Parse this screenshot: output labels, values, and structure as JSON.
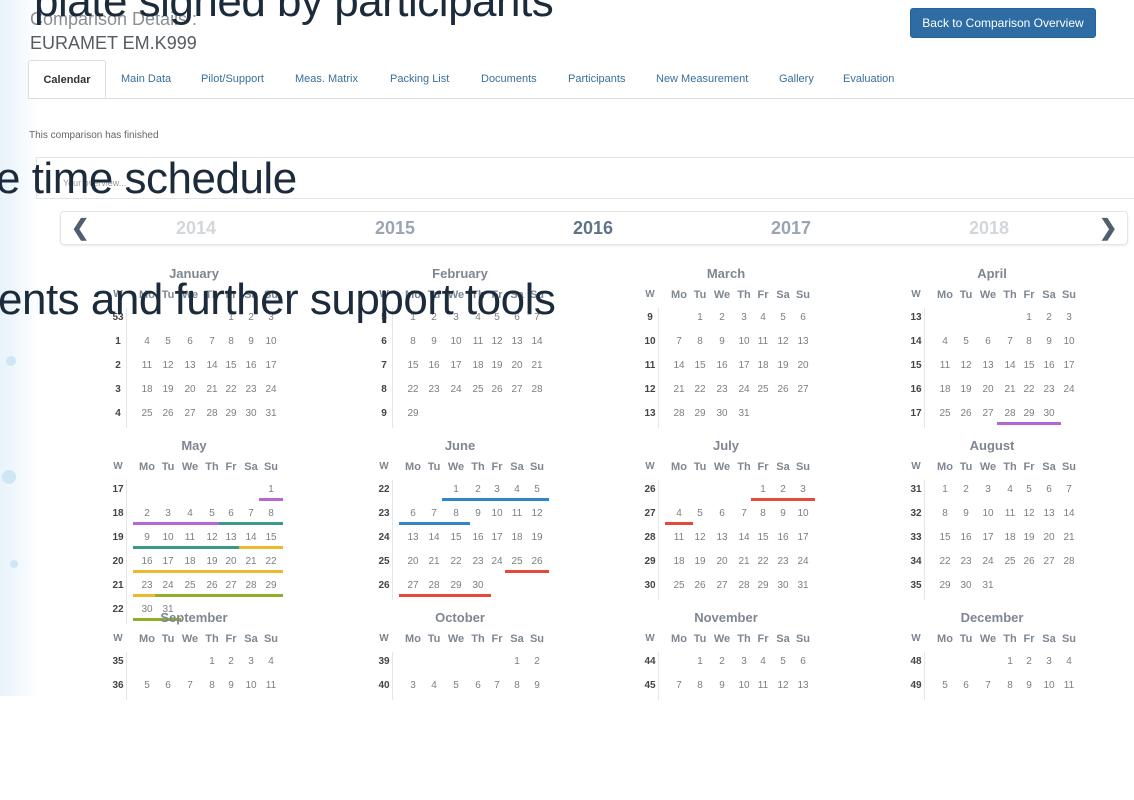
{
  "header": {
    "title": "Comparison Details :",
    "subtitle": "EURAMET EM.K999",
    "back_button": "Back to Comparison Overview"
  },
  "tabs": [
    "Calendar",
    "Main Data",
    "Pilot/Support",
    "Meas. Matrix",
    "Packing List",
    "Documents",
    "Participants",
    "New Measurement",
    "Gallery",
    "Evaluation"
  ],
  "status_text": "This comparison has finished",
  "overview_placeholder": "Your overview...",
  "overlay_texts": [
    "plate signed by participants",
    "e time schedule",
    "ents and further support tools"
  ],
  "years": [
    "2014",
    "2015",
    "2016",
    "2017",
    "2018"
  ],
  "active_year": "2016",
  "weekday_header": [
    "W",
    "Mo",
    "Tu",
    "We",
    "Th",
    "Fr",
    "Sa",
    "Su"
  ],
  "colors": {
    "purple": "#b567d9",
    "teal": "#3a9a8a",
    "yellow": "#f0b92b",
    "olive": "#8fae2b",
    "blue": "#2e86c9",
    "red": "#e8483a",
    "primary_button": "#2e6da4"
  },
  "months": [
    {
      "name": "January",
      "start": 4,
      "days": 31,
      "weeks": [
        "53",
        "1",
        "2",
        "3",
        "4"
      ],
      "underlines": []
    },
    {
      "name": "February",
      "start": 0,
      "days": 29,
      "weeks": [
        "5",
        "6",
        "7",
        "8",
        "9"
      ],
      "underlines": []
    },
    {
      "name": "March",
      "start": 1,
      "days": 31,
      "weeks": [
        "9",
        "10",
        "11",
        "12",
        "13"
      ],
      "underlines": []
    },
    {
      "name": "April",
      "start": 4,
      "days": 30,
      "weeks": [
        "13",
        "14",
        "15",
        "16",
        "17"
      ],
      "underlines": [
        {
          "from": 28,
          "to": 30,
          "color": "purple"
        }
      ]
    },
    {
      "name": "May",
      "start": 6,
      "days": 31,
      "weeks": [
        "17",
        "18",
        "19",
        "20",
        "21",
        "22"
      ],
      "underlines": [
        {
          "from": 1,
          "to": 1,
          "color": "purple"
        },
        {
          "from": 2,
          "to": 5,
          "color": "purple"
        },
        {
          "from": 6,
          "to": 8,
          "color": "teal"
        },
        {
          "from": 9,
          "to": 13,
          "color": "teal"
        },
        {
          "from": 14,
          "to": 15,
          "color": "yellow"
        },
        {
          "from": 16,
          "to": 22,
          "color": "yellow"
        },
        {
          "from": 23,
          "to": 23,
          "color": "yellow"
        },
        {
          "from": 24,
          "to": 29,
          "color": "olive"
        },
        {
          "from": 30,
          "to": 31,
          "color": "olive"
        }
      ]
    },
    {
      "name": "June",
      "start": 2,
      "days": 30,
      "weeks": [
        "22",
        "23",
        "24",
        "25",
        "26"
      ],
      "underlines": [
        {
          "from": 1,
          "to": 5,
          "color": "blue"
        },
        {
          "from": 6,
          "to": 8,
          "color": "blue"
        },
        {
          "from": 25,
          "to": 26,
          "color": "red"
        },
        {
          "from": 27,
          "to": 30,
          "color": "red"
        }
      ]
    },
    {
      "name": "July",
      "start": 4,
      "days": 31,
      "weeks": [
        "26",
        "27",
        "28",
        "29",
        "30"
      ],
      "underlines": [
        {
          "from": 1,
          "to": 3,
          "color": "red"
        },
        {
          "from": 4,
          "to": 4,
          "color": "red"
        }
      ]
    },
    {
      "name": "August",
      "start": 0,
      "days": 31,
      "weeks": [
        "31",
        "32",
        "33",
        "34",
        "35"
      ],
      "underlines": []
    },
    {
      "name": "September",
      "start": 3,
      "days": 30,
      "weeks": [
        "35",
        "36"
      ],
      "underlines": []
    },
    {
      "name": "October",
      "start": 5,
      "days": 31,
      "weeks": [
        "39",
        "40"
      ],
      "underlines": []
    },
    {
      "name": "November",
      "start": 1,
      "days": 30,
      "weeks": [
        "44",
        "45"
      ],
      "underlines": []
    },
    {
      "name": "December",
      "start": 3,
      "days": 31,
      "weeks": [
        "48",
        "49"
      ],
      "underlines": []
    }
  ]
}
